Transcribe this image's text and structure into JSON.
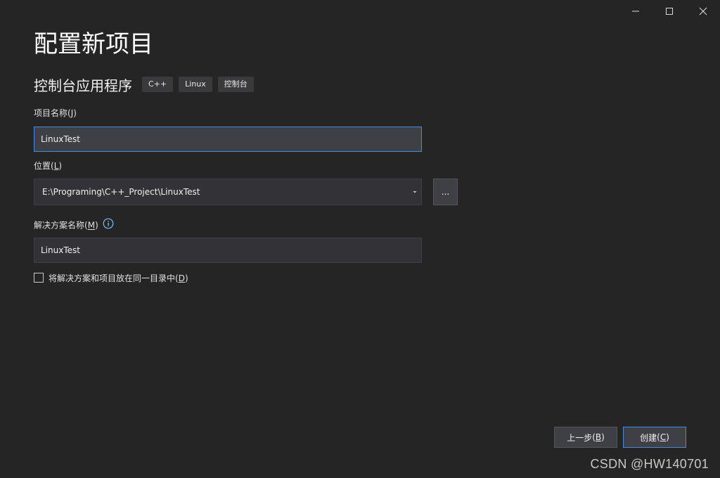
{
  "window": {
    "title": "配置新项目",
    "controls": {
      "minimize_icon": "minimize-icon",
      "maximize_icon": "maximize-icon",
      "close_icon": "close-icon"
    }
  },
  "template": {
    "name": "控制台应用程序",
    "tags": [
      "C++",
      "Linux",
      "控制台"
    ]
  },
  "project_name": {
    "label": "项目名称",
    "mnemonic_open": "(",
    "mnemonic": "J",
    "mnemonic_close": ")",
    "value": "LinuxTest"
  },
  "location": {
    "label": "位置",
    "mnemonic_open": "(",
    "mnemonic": "L",
    "mnemonic_close": ")",
    "value": "E:\\Programing\\C++_Project\\LinuxTest",
    "browse_label": "..."
  },
  "solution_name": {
    "label": "解决方案名称",
    "mnemonic_open": "(",
    "mnemonic": "M",
    "mnemonic_close": ")",
    "value": "LinuxTest",
    "info_icon": "info-icon"
  },
  "same_directory": {
    "label": "将解决方案和项目放在同一目录中",
    "mnemonic_open": "(",
    "mnemonic": "D",
    "mnemonic_close": ")",
    "checked": false
  },
  "footer": {
    "back": {
      "label": "上一步",
      "mnemonic_open": "(",
      "mnemonic": "B",
      "mnemonic_close": ")"
    },
    "create": {
      "label": "创建",
      "mnemonic_open": "(",
      "mnemonic": "C",
      "mnemonic_close": ")"
    }
  },
  "watermark": "CSDN @HW140701",
  "colors": {
    "background": "#252526",
    "input_bg": "#333337",
    "focus_border": "#3c8ee6",
    "tag_bg": "#3a3a3d"
  }
}
